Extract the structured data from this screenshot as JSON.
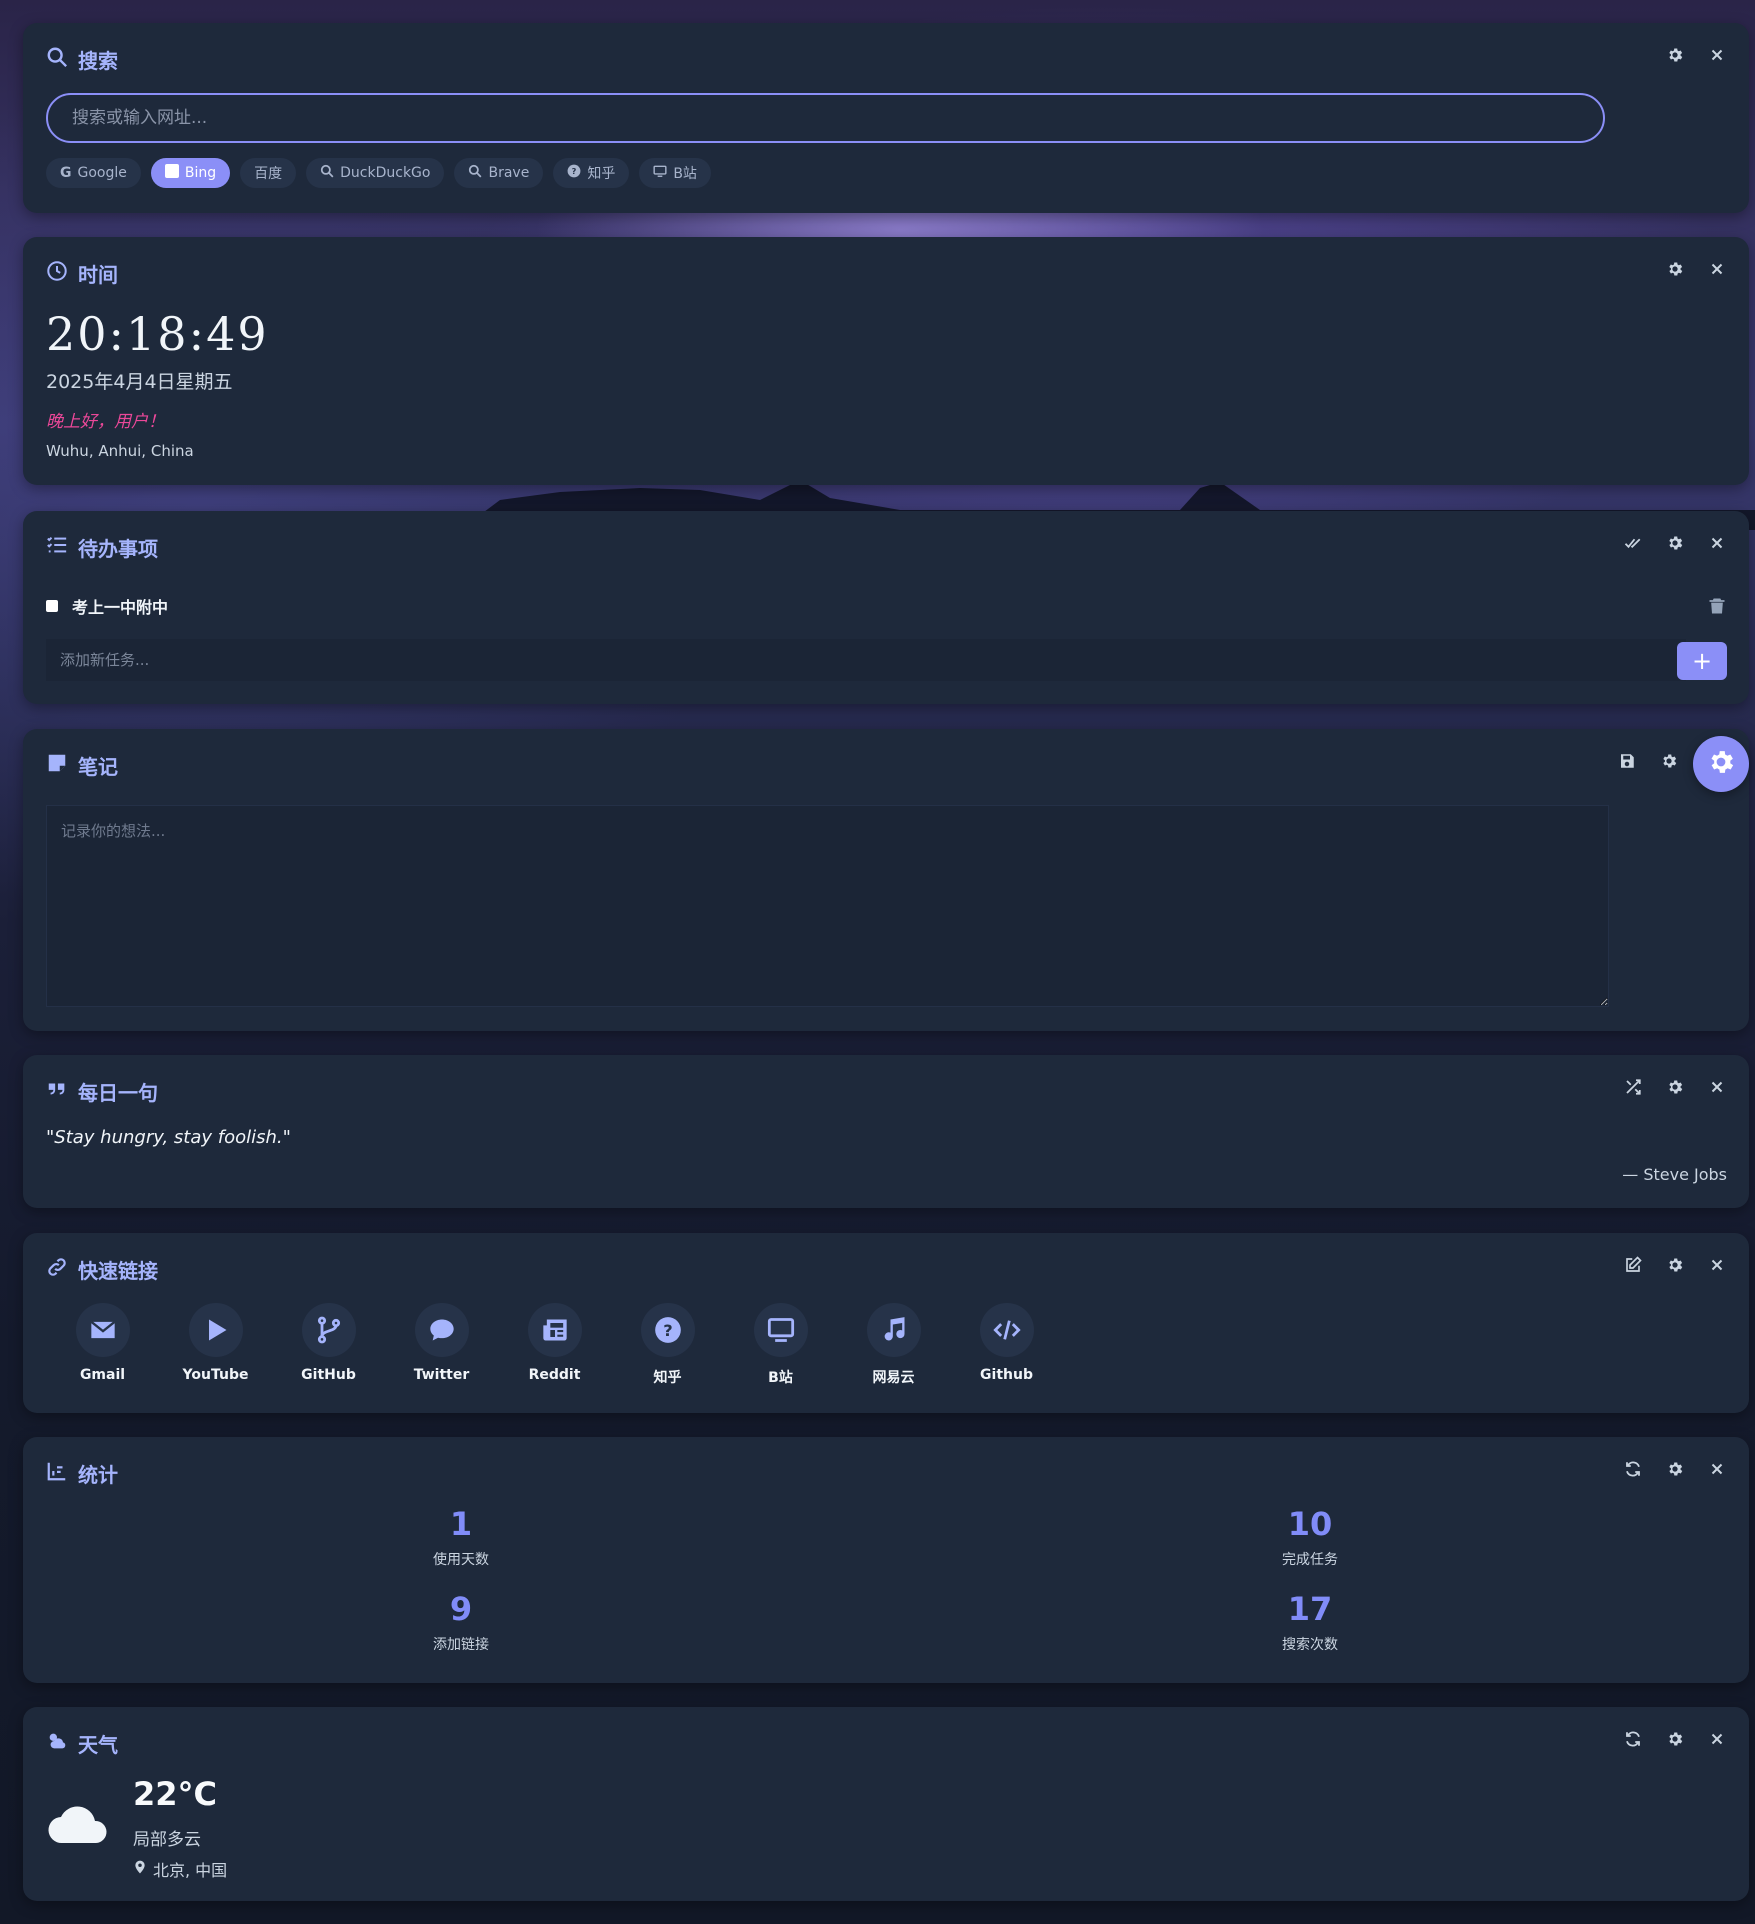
{
  "search": {
    "title": "搜索",
    "placeholder": "搜索或输入网址...",
    "engines": [
      "Google",
      "Bing",
      "百度",
      "DuckDuckGo",
      "Brave",
      "知乎",
      "B站"
    ],
    "active_engine": "Bing"
  },
  "time": {
    "title": "时间",
    "clock": "20:18:49",
    "date": "2025年4月4日星期五",
    "greeting": "晚上好，用户！",
    "location": "Wuhu, Anhui, China"
  },
  "todo": {
    "title": "待办事项",
    "items": [
      {
        "text": "考上一中附中",
        "done": false
      }
    ],
    "placeholder": "添加新任务...",
    "add_label": "+"
  },
  "notes": {
    "title": "笔记",
    "placeholder": "记录你的想法..."
  },
  "quote": {
    "title": "每日一句",
    "text": "\"Stay hungry, stay foolish.\"",
    "author": "— Steve Jobs"
  },
  "links": {
    "title": "快速链接",
    "items": [
      {
        "label": "Gmail",
        "icon": "envelope-icon"
      },
      {
        "label": "YouTube",
        "icon": "play-icon"
      },
      {
        "label": "GitHub",
        "icon": "code-branch-icon"
      },
      {
        "label": "Twitter",
        "icon": "comment-icon"
      },
      {
        "label": "Reddit",
        "icon": "newspaper-icon"
      },
      {
        "label": "知乎",
        "icon": "question-circle-icon"
      },
      {
        "label": "B站",
        "icon": "monitor-icon"
      },
      {
        "label": "网易云",
        "icon": "music-icon"
      },
      {
        "label": "Github",
        "icon": "code-icon"
      }
    ]
  },
  "stats": {
    "title": "统计",
    "items": [
      {
        "value": "1",
        "label": "使用天数"
      },
      {
        "value": "10",
        "label": "完成任务"
      },
      {
        "value": "9",
        "label": "添加链接"
      },
      {
        "value": "17",
        "label": "搜索次数"
      }
    ]
  },
  "weather": {
    "title": "天气",
    "temp": "22°C",
    "desc": "局部多云",
    "location": "北京, 中国"
  },
  "colors": {
    "accent": "#8b8ff7",
    "card_bg": "#1e293b",
    "greeting": "#ec4899",
    "stat_value": "#818cf8"
  }
}
